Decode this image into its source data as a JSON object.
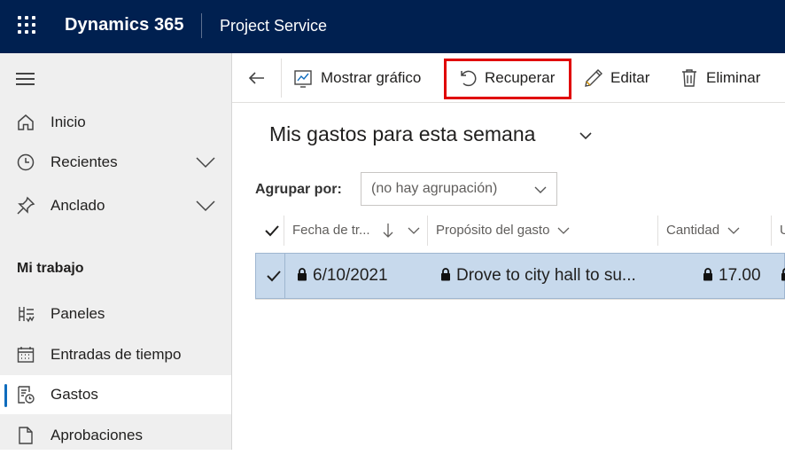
{
  "header": {
    "brand": "Dynamics 365",
    "app_name": "Project Service"
  },
  "sidebar": {
    "section_title": "Mi trabajo",
    "items": [
      {
        "label": "Inicio"
      },
      {
        "label": "Recientes"
      },
      {
        "label": "Anclado"
      },
      {
        "label": "Paneles"
      },
      {
        "label": "Entradas de tiempo"
      },
      {
        "label": "Gastos"
      },
      {
        "label": "Aprobaciones"
      }
    ],
    "active_item": "Gastos"
  },
  "toolbar": {
    "show_chart_label": "Mostrar gráfico",
    "recover_label": "Recuperar",
    "edit_label": "Editar",
    "delete_label": "Eliminar"
  },
  "view": {
    "title": "Mis gastos para esta semana"
  },
  "grouping": {
    "label": "Agrupar por:",
    "value": "(no hay agrupación)"
  },
  "grid": {
    "columns": [
      "Fecha de tr...",
      "Propósito del gasto",
      "Cantidad",
      "U"
    ],
    "rows": [
      {
        "date": "6/10/2021",
        "purpose": "Drove to city hall to su...",
        "amount": "17.00",
        "selected": true
      }
    ]
  },
  "colors": {
    "topbar": "#002050",
    "accent": "#0f6cbd",
    "highlight": "#e00000",
    "selected_row": "#c7d9ec"
  }
}
